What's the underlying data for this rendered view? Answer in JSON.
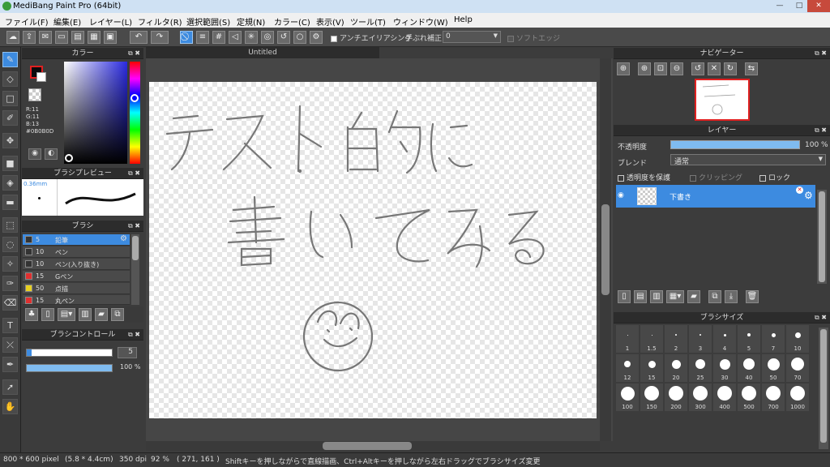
{
  "window": {
    "title": "MediBang Paint Pro (64bit)"
  },
  "menu": [
    "ファイル(F)",
    "編集(E)",
    "レイヤー(L)",
    "フィルタ(R)",
    "選択範囲(S)",
    "定規(N)",
    "カラー(C)",
    "表示(V)",
    "ツール(T)",
    "ウィンドウ(W)",
    "Help"
  ],
  "toolbar": {
    "antialias_label": "アンチエイリアシング",
    "stabilizer_label": "手ぶれ補正",
    "stabilizer_value": "0",
    "soft_edge_label": "ソフトエッジ"
  },
  "color_panel": {
    "title": "カラー",
    "r": "R:11",
    "g": "G:11",
    "b": "B:13",
    "hex": "#0B0B0D"
  },
  "brush_preview": {
    "title": "ブラシプレビュー",
    "size": "0.36mm"
  },
  "brush_panel": {
    "title": "ブラシ",
    "items": [
      {
        "size": "5",
        "name": "鉛筆",
        "color": "#333333"
      },
      {
        "size": "10",
        "name": "ペン",
        "color": "#333333"
      },
      {
        "size": "10",
        "name": "ペン(入り抜き)",
        "color": "#333333"
      },
      {
        "size": "15",
        "name": "Gペン",
        "color": "#e03030"
      },
      {
        "size": "50",
        "name": "点描",
        "color": "#e8d020"
      },
      {
        "size": "15",
        "name": "丸ペン",
        "color": "#e03030"
      }
    ]
  },
  "brush_control": {
    "title": "ブラシコントロール",
    "size_value": "5",
    "opacity_value": "100 %"
  },
  "canvas": {
    "tab_title": "Untitled"
  },
  "navigator": {
    "title": "ナビゲーター"
  },
  "layer_panel": {
    "title": "レイヤー",
    "opacity_label": "不透明度",
    "opacity_value": "100 %",
    "blend_label": "ブレンド",
    "blend_value": "通常",
    "protect_label": "透明度を保護",
    "clipping_label": "クリッピング",
    "lock_label": "ロック",
    "layer_name": "下書き"
  },
  "brush_size_panel": {
    "title": "ブラシサイズ",
    "sizes": [
      "1",
      "1.5",
      "2",
      "3",
      "4",
      "5",
      "7",
      "10",
      "12",
      "15",
      "20",
      "25",
      "30",
      "40",
      "50",
      "70",
      "100",
      "150",
      "200",
      "300",
      "400",
      "500",
      "700",
      "1000"
    ]
  },
  "status": {
    "doc_size": "800 * 600 pixel",
    "phys_size": "(5.8 * 4.4cm)",
    "dpi": "350 dpi",
    "zoom": "92 %",
    "cursor": "( 271, 161 )",
    "hint": "Shiftキーを押しながらで直線描画、Ctrl+Altキーを押しながら左右ドラッグでブラシサイズ変更"
  },
  "colors": {
    "accent": "#3d8be0",
    "fg": "#0B0B0D"
  }
}
